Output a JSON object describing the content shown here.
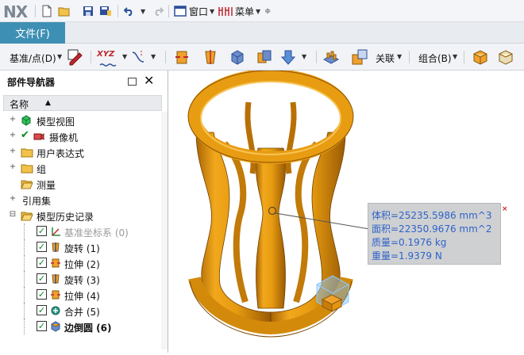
{
  "app": {
    "logo": "NX"
  },
  "quick_access": {
    "window_menu": "窗口",
    "menu_menu": "菜单"
  },
  "ribbon": {
    "file_tab": "文件(F)"
  },
  "toolbar": {
    "datum_point": "基准/点(D)",
    "xyz_label": "XYZ",
    "associate": "关联",
    "combine": "组合(B)"
  },
  "navigator": {
    "title": "部件导航器",
    "column_name": "名称",
    "nodes": [
      {
        "label": "模型视图",
        "icon": "model-views-icon"
      },
      {
        "label": "摄像机",
        "icon": "camera-icon"
      },
      {
        "label": "用户表达式",
        "icon": "folder-icon"
      },
      {
        "label": "组",
        "icon": "folder-icon"
      },
      {
        "label": "测量",
        "icon": "folder-open-icon"
      },
      {
        "label": "引用集",
        "icon": "none"
      },
      {
        "label": "模型历史记录",
        "icon": "folder-open-icon"
      }
    ],
    "features": [
      {
        "label": "基准坐标系 (0)",
        "icon": "datum-csys-icon",
        "checked": true
      },
      {
        "label": "旋转 (1)",
        "icon": "revolve-icon",
        "checked": true
      },
      {
        "label": "拉伸 (2)",
        "icon": "extrude-icon",
        "checked": true
      },
      {
        "label": "旋转 (3)",
        "icon": "revolve-icon",
        "checked": true
      },
      {
        "label": "拉伸 (4)",
        "icon": "extrude-icon",
        "checked": true
      },
      {
        "label": "合并 (5)",
        "icon": "unite-icon",
        "checked": true
      },
      {
        "label": "边倒圆 (6)",
        "icon": "edge-blend-icon",
        "checked": true
      }
    ]
  },
  "measurement": {
    "volume": "体积=25235.5986 mm^3",
    "area": "面积=22350.9676 mm^2",
    "mass": "质量=0.1976 kg",
    "weight": "重量=1.9379 N",
    "close": "×"
  },
  "colors": {
    "part_orange": "#e9a01a",
    "part_dark": "#b06d05",
    "ribbon_blue": "#3e8fb4",
    "measure_text": "#2e63c8"
  }
}
